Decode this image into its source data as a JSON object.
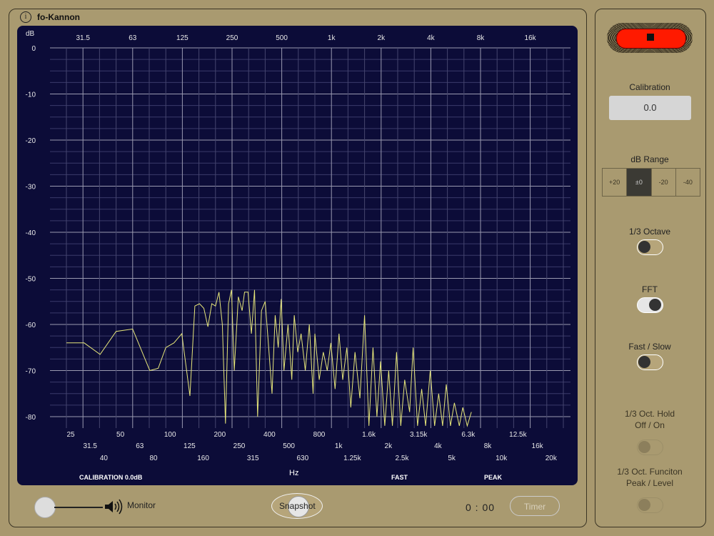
{
  "app": {
    "title": "fo-Kannon",
    "info_icon": "info-icon"
  },
  "chart": {
    "y_unit": "dB",
    "y_ticks": [
      "0",
      "-10",
      "-20",
      "-30",
      "-40",
      "-50",
      "-60",
      "-70",
      "-80"
    ],
    "top_ticks": [
      "31.5",
      "63",
      "125",
      "250",
      "500",
      "1k",
      "2k",
      "4k",
      "8k",
      "16k"
    ],
    "bottom_row1": [
      "25",
      "50",
      "100",
      "200",
      "400",
      "800",
      "1.6k",
      "3.15k",
      "6.3k",
      "12.5k"
    ],
    "bottom_row2": [
      "31.5",
      "63",
      "125",
      "250",
      "500",
      "1k",
      "2k",
      "4k",
      "8k",
      "16k"
    ],
    "bottom_row3": [
      "40",
      "80",
      "160",
      "315",
      "630",
      "1.25k",
      "2.5k",
      "5k",
      "10k",
      "20k"
    ],
    "x_unit": "Hz",
    "status_calibration": "CALIBRATION 0.0dB",
    "status_speed": "FAST",
    "status_mode": "PEAK",
    "trace_color": "#e6e67a"
  },
  "chart_data": {
    "type": "line",
    "title": "",
    "xlabel": "Hz",
    "ylabel": "dB",
    "x_scale": "log",
    "ylim": [
      -83,
      0
    ],
    "series": [
      {
        "x": [
          25,
          32,
          40,
          50,
          63,
          80,
          90,
          100,
          112,
          125,
          140,
          150,
          160,
          170,
          180,
          190,
          200,
          210,
          220,
          230,
          240,
          250,
          260,
          275,
          290,
          300,
          315,
          330,
          345,
          360,
          380,
          400,
          420,
          440,
          460,
          480,
          500,
          520,
          550,
          580,
          600,
          630,
          660,
          700,
          740,
          780,
          800,
          850,
          900,
          950,
          1000,
          1060,
          1120,
          1180,
          1250,
          1320,
          1400,
          1500,
          1600,
          1700,
          1800,
          1900,
          2000,
          2120,
          2240,
          2360,
          2500,
          2650,
          2800,
          3000,
          3150,
          3350,
          3550,
          3750,
          4000,
          4250,
          4500,
          4750,
          5000,
          5300,
          5600,
          6000,
          6300,
          6700,
          7100
        ],
        "y": [
          -64,
          -64,
          -66.5,
          -61.5,
          -61,
          -70,
          -69.5,
          -65,
          -64,
          -62,
          -75.5,
          -56,
          -55.5,
          -56.5,
          -60.5,
          -55.5,
          -56,
          -53,
          -60,
          -81.5,
          -55.5,
          -52.5,
          -70,
          -54,
          -57,
          -53,
          -53,
          -62,
          -52.5,
          -80,
          -57,
          -55,
          -65,
          -75,
          -58,
          -65,
          -54.5,
          -70,
          -60,
          -72,
          -58,
          -66,
          -62,
          -70,
          -60,
          -75,
          -62,
          -72,
          -66,
          -70,
          -64,
          -74,
          -62,
          -72,
          -65,
          -78,
          -66,
          -76,
          -58,
          -82,
          -65,
          -80,
          -68,
          -82,
          -70,
          -82,
          -66,
          -82,
          -72,
          -79,
          -65,
          -82,
          -74,
          -82,
          -70,
          -82,
          -75,
          -82,
          -73,
          -82,
          -77,
          -82,
          -78,
          -82,
          -79
        ]
      }
    ]
  },
  "footer": {
    "monitor_label": "Monitor",
    "snapshot_label": "Snapshot",
    "time": "0 : 00",
    "timer_label": "Timer"
  },
  "side": {
    "record_state": "recording",
    "record_color": "#ff1a00",
    "calibration_label": "Calibration",
    "calibration_value": "0.0",
    "db_range_label": "dB Range",
    "db_range_options": [
      "+20",
      "±0",
      "-20",
      "-40"
    ],
    "db_range_selected": "±0",
    "octave_label": "1/3 Octave",
    "octave_on": false,
    "fft_label": "FFT",
    "fft_on": true,
    "fast_slow_label": "Fast / Slow",
    "fast_slow_on": false,
    "hold_label_line1": "1/3 Oct. Hold",
    "hold_label_line2": "Off / On",
    "hold_enabled": false,
    "function_label_line1": "1/3 Oct. Funciton",
    "function_label_line2": "Peak / Level",
    "function_enabled": false
  }
}
